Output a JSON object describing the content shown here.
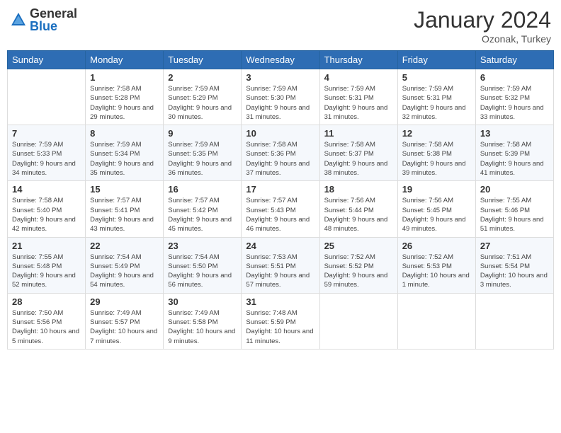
{
  "header": {
    "logo_general": "General",
    "logo_blue": "Blue",
    "month_title": "January 2024",
    "subtitle": "Ozonak, Turkey"
  },
  "days_of_week": [
    "Sunday",
    "Monday",
    "Tuesday",
    "Wednesday",
    "Thursday",
    "Friday",
    "Saturday"
  ],
  "weeks": [
    [
      {
        "day": "",
        "sunrise": "",
        "sunset": "",
        "daylight": ""
      },
      {
        "day": "1",
        "sunrise": "Sunrise: 7:58 AM",
        "sunset": "Sunset: 5:28 PM",
        "daylight": "Daylight: 9 hours and 29 minutes."
      },
      {
        "day": "2",
        "sunrise": "Sunrise: 7:59 AM",
        "sunset": "Sunset: 5:29 PM",
        "daylight": "Daylight: 9 hours and 30 minutes."
      },
      {
        "day": "3",
        "sunrise": "Sunrise: 7:59 AM",
        "sunset": "Sunset: 5:30 PM",
        "daylight": "Daylight: 9 hours and 31 minutes."
      },
      {
        "day": "4",
        "sunrise": "Sunrise: 7:59 AM",
        "sunset": "Sunset: 5:31 PM",
        "daylight": "Daylight: 9 hours and 31 minutes."
      },
      {
        "day": "5",
        "sunrise": "Sunrise: 7:59 AM",
        "sunset": "Sunset: 5:31 PM",
        "daylight": "Daylight: 9 hours and 32 minutes."
      },
      {
        "day": "6",
        "sunrise": "Sunrise: 7:59 AM",
        "sunset": "Sunset: 5:32 PM",
        "daylight": "Daylight: 9 hours and 33 minutes."
      }
    ],
    [
      {
        "day": "7",
        "sunrise": "Sunrise: 7:59 AM",
        "sunset": "Sunset: 5:33 PM",
        "daylight": "Daylight: 9 hours and 34 minutes."
      },
      {
        "day": "8",
        "sunrise": "Sunrise: 7:59 AM",
        "sunset": "Sunset: 5:34 PM",
        "daylight": "Daylight: 9 hours and 35 minutes."
      },
      {
        "day": "9",
        "sunrise": "Sunrise: 7:59 AM",
        "sunset": "Sunset: 5:35 PM",
        "daylight": "Daylight: 9 hours and 36 minutes."
      },
      {
        "day": "10",
        "sunrise": "Sunrise: 7:58 AM",
        "sunset": "Sunset: 5:36 PM",
        "daylight": "Daylight: 9 hours and 37 minutes."
      },
      {
        "day": "11",
        "sunrise": "Sunrise: 7:58 AM",
        "sunset": "Sunset: 5:37 PM",
        "daylight": "Daylight: 9 hours and 38 minutes."
      },
      {
        "day": "12",
        "sunrise": "Sunrise: 7:58 AM",
        "sunset": "Sunset: 5:38 PM",
        "daylight": "Daylight: 9 hours and 39 minutes."
      },
      {
        "day": "13",
        "sunrise": "Sunrise: 7:58 AM",
        "sunset": "Sunset: 5:39 PM",
        "daylight": "Daylight: 9 hours and 41 minutes."
      }
    ],
    [
      {
        "day": "14",
        "sunrise": "Sunrise: 7:58 AM",
        "sunset": "Sunset: 5:40 PM",
        "daylight": "Daylight: 9 hours and 42 minutes."
      },
      {
        "day": "15",
        "sunrise": "Sunrise: 7:57 AM",
        "sunset": "Sunset: 5:41 PM",
        "daylight": "Daylight: 9 hours and 43 minutes."
      },
      {
        "day": "16",
        "sunrise": "Sunrise: 7:57 AM",
        "sunset": "Sunset: 5:42 PM",
        "daylight": "Daylight: 9 hours and 45 minutes."
      },
      {
        "day": "17",
        "sunrise": "Sunrise: 7:57 AM",
        "sunset": "Sunset: 5:43 PM",
        "daylight": "Daylight: 9 hours and 46 minutes."
      },
      {
        "day": "18",
        "sunrise": "Sunrise: 7:56 AM",
        "sunset": "Sunset: 5:44 PM",
        "daylight": "Daylight: 9 hours and 48 minutes."
      },
      {
        "day": "19",
        "sunrise": "Sunrise: 7:56 AM",
        "sunset": "Sunset: 5:45 PM",
        "daylight": "Daylight: 9 hours and 49 minutes."
      },
      {
        "day": "20",
        "sunrise": "Sunrise: 7:55 AM",
        "sunset": "Sunset: 5:46 PM",
        "daylight": "Daylight: 9 hours and 51 minutes."
      }
    ],
    [
      {
        "day": "21",
        "sunrise": "Sunrise: 7:55 AM",
        "sunset": "Sunset: 5:48 PM",
        "daylight": "Daylight: 9 hours and 52 minutes."
      },
      {
        "day": "22",
        "sunrise": "Sunrise: 7:54 AM",
        "sunset": "Sunset: 5:49 PM",
        "daylight": "Daylight: 9 hours and 54 minutes."
      },
      {
        "day": "23",
        "sunrise": "Sunrise: 7:54 AM",
        "sunset": "Sunset: 5:50 PM",
        "daylight": "Daylight: 9 hours and 56 minutes."
      },
      {
        "day": "24",
        "sunrise": "Sunrise: 7:53 AM",
        "sunset": "Sunset: 5:51 PM",
        "daylight": "Daylight: 9 hours and 57 minutes."
      },
      {
        "day": "25",
        "sunrise": "Sunrise: 7:52 AM",
        "sunset": "Sunset: 5:52 PM",
        "daylight": "Daylight: 9 hours and 59 minutes."
      },
      {
        "day": "26",
        "sunrise": "Sunrise: 7:52 AM",
        "sunset": "Sunset: 5:53 PM",
        "daylight": "Daylight: 10 hours and 1 minute."
      },
      {
        "day": "27",
        "sunrise": "Sunrise: 7:51 AM",
        "sunset": "Sunset: 5:54 PM",
        "daylight": "Daylight: 10 hours and 3 minutes."
      }
    ],
    [
      {
        "day": "28",
        "sunrise": "Sunrise: 7:50 AM",
        "sunset": "Sunset: 5:56 PM",
        "daylight": "Daylight: 10 hours and 5 minutes."
      },
      {
        "day": "29",
        "sunrise": "Sunrise: 7:49 AM",
        "sunset": "Sunset: 5:57 PM",
        "daylight": "Daylight: 10 hours and 7 minutes."
      },
      {
        "day": "30",
        "sunrise": "Sunrise: 7:49 AM",
        "sunset": "Sunset: 5:58 PM",
        "daylight": "Daylight: 10 hours and 9 minutes."
      },
      {
        "day": "31",
        "sunrise": "Sunrise: 7:48 AM",
        "sunset": "Sunset: 5:59 PM",
        "daylight": "Daylight: 10 hours and 11 minutes."
      },
      {
        "day": "",
        "sunrise": "",
        "sunset": "",
        "daylight": ""
      },
      {
        "day": "",
        "sunrise": "",
        "sunset": "",
        "daylight": ""
      },
      {
        "day": "",
        "sunrise": "",
        "sunset": "",
        "daylight": ""
      }
    ]
  ]
}
